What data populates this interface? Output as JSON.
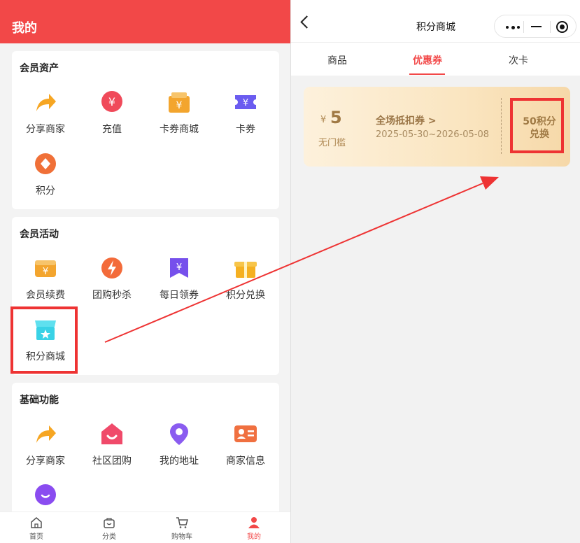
{
  "left": {
    "header_title": "我的",
    "sections": [
      {
        "title": "会员资产",
        "items": [
          {
            "label": "分享商家",
            "icon": "share-arrow-icon",
            "color": "#f6a623"
          },
          {
            "label": "充值",
            "icon": "yuan-coin-icon",
            "color": "#f04a5a"
          },
          {
            "label": "卡券商城",
            "icon": "card-store-icon",
            "color": "#f3a52e"
          },
          {
            "label": "卡券",
            "icon": "ticket-icon",
            "color": "#6b5cf0"
          },
          {
            "label": "积分",
            "icon": "points-diamond-icon",
            "color": "#f07038"
          }
        ]
      },
      {
        "title": "会员活动",
        "items": [
          {
            "label": "会员续费",
            "icon": "renew-yuan-icon",
            "color": "#f3a52e"
          },
          {
            "label": "团购秒杀",
            "icon": "lightning-icon",
            "color": "#f36b3a"
          },
          {
            "label": "每日领券",
            "icon": "bookmark-yuan-icon",
            "color": "#7650ec"
          },
          {
            "label": "积分兑换",
            "icon": "gift-icon",
            "color": "#f5b021"
          },
          {
            "label": "积分商城",
            "icon": "store-star-icon",
            "color": "#39d2e6"
          }
        ]
      },
      {
        "title": "基础功能",
        "items": [
          {
            "label": "分享商家",
            "icon": "share-arrow-icon",
            "color": "#f6a623"
          },
          {
            "label": "社区团购",
            "icon": "house-smile-icon",
            "color": "#f04a6a"
          },
          {
            "label": "我的地址",
            "icon": "location-pin-icon",
            "color": "#8a5cf0"
          },
          {
            "label": "商家信息",
            "icon": "id-card-icon",
            "color": "#f07040"
          },
          {
            "label": "",
            "icon": "chat-bubble-icon",
            "color": "#8a4cf0"
          }
        ]
      }
    ],
    "tabbar": [
      {
        "label": "首页",
        "icon": "home-icon"
      },
      {
        "label": "分类",
        "icon": "category-bag-icon"
      },
      {
        "label": "购物车",
        "icon": "cart-icon"
      },
      {
        "label": "我的",
        "icon": "user-icon",
        "active": true
      }
    ],
    "accent_color": "#f24848"
  },
  "right": {
    "nav_title": "积分商城",
    "tabs": [
      {
        "label": "商品"
      },
      {
        "label": "优惠券",
        "active": true
      },
      {
        "label": "次卡"
      }
    ],
    "coupon": {
      "currency": "¥",
      "amount": "5",
      "condition": "无门槛",
      "name": "全场抵扣券 >",
      "date_range": "2025-05-30~2026-05-08",
      "button_line1": "50积分",
      "button_line2": "兑换"
    }
  },
  "annotation": {
    "highlight_color": "#ee3333"
  }
}
